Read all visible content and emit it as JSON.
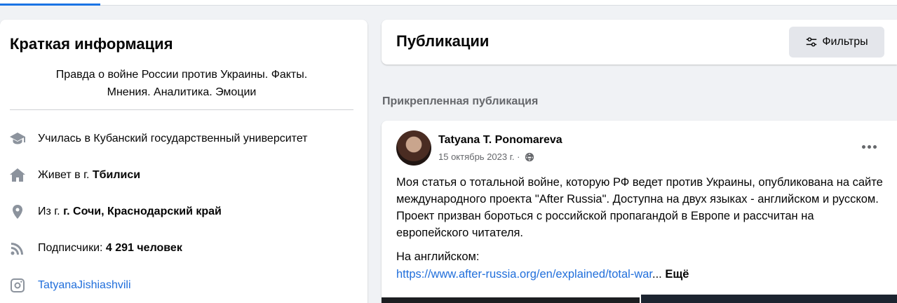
{
  "intro": {
    "title": "Краткая информация",
    "bio_line1": "Правда о войне России против Украины. Факты.",
    "bio_line2": "Мнения. Аналитика. Эмоции",
    "education": "Училась в Кубанский государственный университет",
    "lives_prefix": "Живет в г. ",
    "lives_city": "Тбилиси",
    "from_prefix": "Из г. ",
    "from_city": "г. Сочи, Краснодарский край",
    "followers_prefix": "Подписчики: ",
    "followers_count": "4 291 человек",
    "instagram": "TatyanaJishiashvili"
  },
  "publications": {
    "title": "Публикации",
    "filters_label": "Фильтры",
    "pinned_label": "Прикрепленная публикация"
  },
  "post": {
    "author": "Tatyana T. Ponomareva",
    "date": "15 октябрь 2023 г. · ",
    "text": "Моя статья о тотальной войне, которую РФ ведет против Украины, опубликована на сайте международного проекта \"After Russia\". Доступна на двух языках - английском и русском. Проект призван бороться с российской пропагандой в Европе и рассчитан на европейского читателя.",
    "lang_label": "На английском:",
    "link": "https://www.after-russia.org/en/explained/total-war",
    "ellipsis": "... ",
    "see_more": "Ещё"
  },
  "colors": {
    "accent": "#1b74e4",
    "link": "#216fdb",
    "icon_gray": "#8c939d",
    "background": "#f0f2f5"
  },
  "icons": [
    "graduation-cap-icon",
    "home-icon",
    "location-pin-icon",
    "rss-feed-icon",
    "instagram-icon",
    "filter-sliders-icon",
    "globe-icon",
    "more-dots-icon"
  ]
}
